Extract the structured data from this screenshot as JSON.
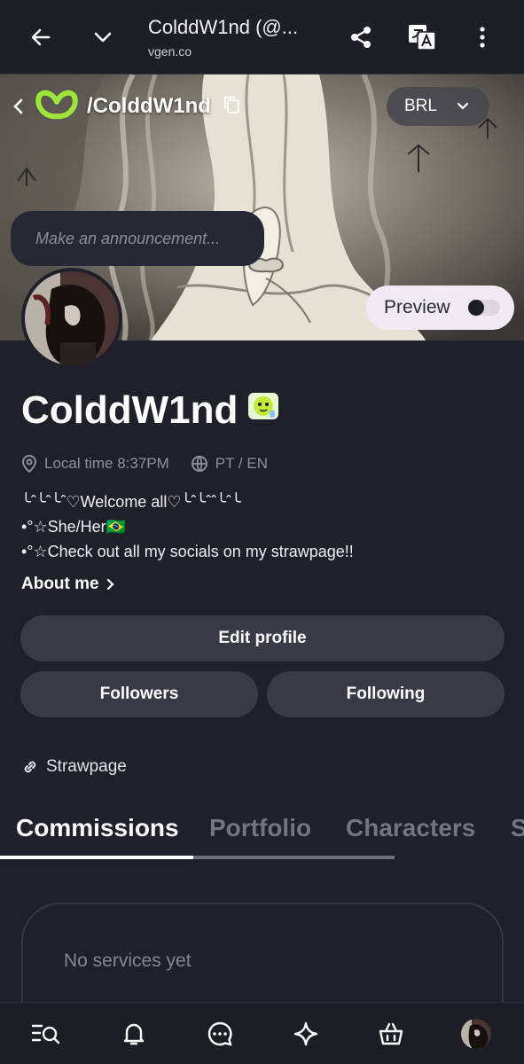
{
  "browser": {
    "title": "ColddW1nd (@...",
    "url": "vgen.co",
    "icons": [
      "back-arrow-icon",
      "chevron-down-icon",
      "share-icon",
      "translate-icon",
      "more-vert-icon"
    ]
  },
  "header": {
    "handle": "/ColddW1nd",
    "currency": "BRL",
    "announcement_placeholder": "Make an announcement...",
    "preview_label": "Preview",
    "preview_on": false
  },
  "profile": {
    "name": "ColddW1nd",
    "local_time": "Local time 8:37PM",
    "languages": "PT / EN",
    "bio": [
      "╰ˆ╰ˆ╰ˆ♡Welcome all♡╰ˆ╰ˆˆ╰ˆ╰",
      "•°☆She/Her🇧🇷",
      "•°☆Check out all my socials on my strawpage!!"
    ],
    "about_me": "About me",
    "edit_profile": "Edit profile",
    "followers": "Followers",
    "following": "Following",
    "link_label": "Strawpage"
  },
  "tabs": [
    {
      "label": "Commissions",
      "active": true
    },
    {
      "label": "Portfolio",
      "active": false
    },
    {
      "label": "Characters",
      "active": false
    },
    {
      "label": "S",
      "active": false
    }
  ],
  "services": {
    "empty_text": "No services yet"
  },
  "bottom_nav": [
    "search-list-icon",
    "bell-icon",
    "chat-icon",
    "sparkle-icon",
    "shopping-bag-icon",
    "profile-avatar"
  ],
  "colors": {
    "background": "#1f2029",
    "card": "#393a45",
    "brand_green": "#9ee53a",
    "muted_text": "#8f909b"
  }
}
